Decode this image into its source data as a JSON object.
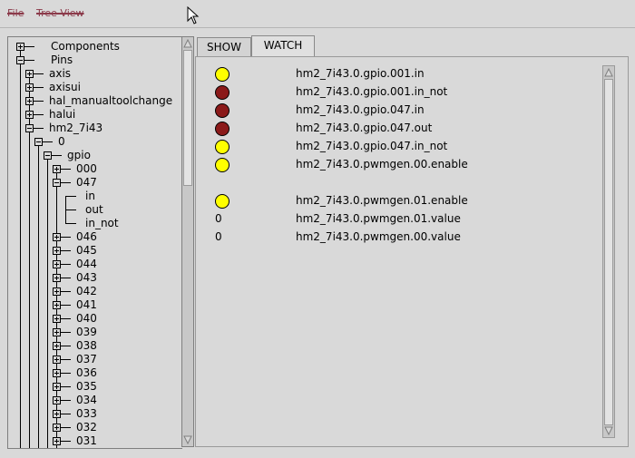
{
  "menubar": {
    "file": "File",
    "tree_view": "Tree View"
  },
  "tree": {
    "components": "Components",
    "pins": "Pins",
    "axis": "axis",
    "axisui": "axisui",
    "hal_manualtoolchange": "hal_manualtoolchange",
    "halui": "halui",
    "hm2_7i43": "hm2_7i43",
    "zero": "0",
    "gpio": "gpio",
    "g000": "000",
    "g047": "047",
    "in": "in",
    "out": "out",
    "in_not": "in_not",
    "pins_list": [
      "046",
      "045",
      "044",
      "043",
      "042",
      "041",
      "040",
      "039",
      "038",
      "037",
      "036",
      "035",
      "034",
      "033",
      "032",
      "031"
    ]
  },
  "tabs": {
    "show": "SHOW",
    "watch": "WATCH"
  },
  "colors": {
    "led_on": "#ffff00",
    "led_off": "#8b1a1a"
  },
  "watch": [
    {
      "kind": "led",
      "state": "on",
      "name": "hm2_7i43.0.gpio.001.in"
    },
    {
      "kind": "led",
      "state": "off",
      "name": "hm2_7i43.0.gpio.001.in_not"
    },
    {
      "kind": "led",
      "state": "off",
      "name": "hm2_7i43.0.gpio.047.in"
    },
    {
      "kind": "led",
      "state": "off",
      "name": "hm2_7i43.0.gpio.047.out"
    },
    {
      "kind": "led",
      "state": "on",
      "name": "hm2_7i43.0.gpio.047.in_not"
    },
    {
      "kind": "led",
      "state": "on",
      "name": "hm2_7i43.0.pwmgen.00.enable"
    },
    {
      "kind": "blank"
    },
    {
      "kind": "led",
      "state": "on",
      "name": "hm2_7i43.0.pwmgen.01.enable"
    },
    {
      "kind": "value",
      "value": "0",
      "name": "hm2_7i43.0.pwmgen.01.value"
    },
    {
      "kind": "value",
      "value": "0",
      "name": "hm2_7i43.0.pwmgen.00.value"
    }
  ]
}
